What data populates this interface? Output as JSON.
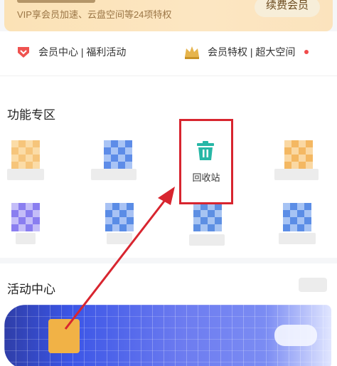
{
  "vip": {
    "subtitle": "VIP享会员加速、云盘空间等24项特权",
    "renew_button": "续费会员"
  },
  "member_links": {
    "left": "会员中心 | 福利活动",
    "right": "会员特权 | 超大空间"
  },
  "functions": {
    "title": "功能专区",
    "recycle_label": "回收站"
  },
  "activity": {
    "title": "活动中心"
  },
  "colors": {
    "accent_red": "#d8252f",
    "recycle_teal": "#27b7a6",
    "vip_gold": "#fbe2b6"
  }
}
